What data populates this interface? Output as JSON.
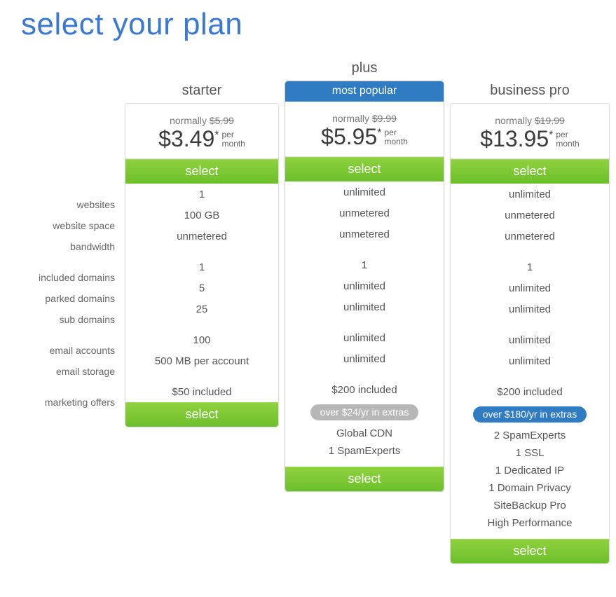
{
  "title": "select your plan",
  "select_label": "select",
  "per_month": "per\nmonth",
  "labels": {
    "websites": "websites",
    "website_space": "website space",
    "bandwidth": "bandwidth",
    "included_domains": "included domains",
    "parked_domains": "parked domains",
    "sub_domains": "sub domains",
    "email_accounts": "email accounts",
    "email_storage": "email storage",
    "marketing_offers": "marketing offers"
  },
  "plans": {
    "starter": {
      "name": "starter",
      "normally_label": "normally",
      "normally_price": "$5.99",
      "price": "$3.49",
      "websites": "1",
      "website_space": "100 GB",
      "bandwidth": "unmetered",
      "included_domains": "1",
      "parked_domains": "5",
      "sub_domains": "25",
      "email_accounts": "100",
      "email_storage": "500 MB per account",
      "marketing_offers": "$50 included"
    },
    "plus": {
      "name": "plus",
      "badge": "most popular",
      "normally_label": "normally",
      "normally_price": "$9.99",
      "price": "$5.95",
      "websites": "unlimited",
      "website_space": "unmetered",
      "bandwidth": "unmetered",
      "included_domains": "1",
      "parked_domains": "unlimited",
      "sub_domains": "unlimited",
      "email_accounts": "unlimited",
      "email_storage": "unlimited",
      "marketing_offers": "$200 included",
      "extras_pill": "over $24/yr in extras",
      "extras": [
        "Global CDN",
        "1 SpamExperts"
      ]
    },
    "business": {
      "name": "business pro",
      "normally_label": "normally",
      "normally_price": "$19.99",
      "price": "$13.95",
      "websites": "unlimited",
      "website_space": "unmetered",
      "bandwidth": "unmetered",
      "included_domains": "1",
      "parked_domains": "unlimited",
      "sub_domains": "unlimited",
      "email_accounts": "unlimited",
      "email_storage": "unlimited",
      "marketing_offers": "$200 included",
      "extras_pill": "over $180/yr in extras",
      "extras": [
        "2 SpamExperts",
        "1 SSL",
        "1 Dedicated IP",
        "1 Domain Privacy",
        "SiteBackup Pro",
        "High Performance"
      ]
    }
  }
}
